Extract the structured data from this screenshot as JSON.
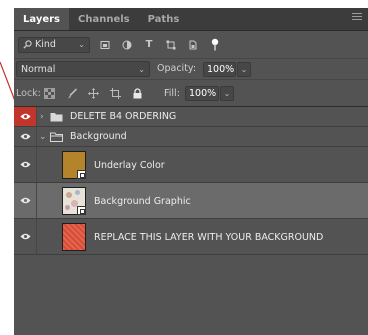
{
  "panel": {
    "tabs": [
      {
        "label": "Layers",
        "active": true
      },
      {
        "label": "Channels",
        "active": false
      },
      {
        "label": "Paths",
        "active": false
      }
    ],
    "menu_icon": "hamburger-icon"
  },
  "filter": {
    "kind_label": "Kind",
    "icons": [
      "pixel-filter-icon",
      "adjustment-filter-icon",
      "type-filter-icon",
      "shape-filter-icon",
      "smart-object-filter-icon",
      "filter-toggle-icon"
    ]
  },
  "blend": {
    "mode": "Normal",
    "opacity_label": "Opacity:",
    "opacity_value": "100%"
  },
  "lock": {
    "label": "Lock:",
    "icons": [
      "lock-transparent-icon",
      "lock-paint-icon",
      "lock-move-icon",
      "lock-artboard-icon",
      "lock-all-icon"
    ],
    "fill_label": "Fill:",
    "fill_value": "100%"
  },
  "layers": [
    {
      "name": "DELETE B4 ORDERING",
      "type": "group",
      "expanded": false,
      "visible": true,
      "eye_color": "#c2352a"
    },
    {
      "name": "Background",
      "type": "group",
      "expanded": true,
      "visible": true
    },
    {
      "name": "Underlay Color",
      "type": "layer",
      "visible": true,
      "thumb_color": "#b3842a",
      "smart_object": true
    },
    {
      "name": "Background Graphic",
      "type": "layer",
      "visible": true,
      "selected": true,
      "thumb_color": "#e8e2d8",
      "smart_object": true
    },
    {
      "name": "REPLACE THIS LAYER WITH YOUR BACKGROUND",
      "type": "layer",
      "visible": true,
      "thumb_color": "#e2523a"
    }
  ],
  "colors": {
    "panel_bg": "#535353",
    "tab_bar": "#3c3c3c",
    "selected_row": "#6b6b6b",
    "eye_highlight": "#c2352a",
    "pointer_line": "#c2352a"
  }
}
